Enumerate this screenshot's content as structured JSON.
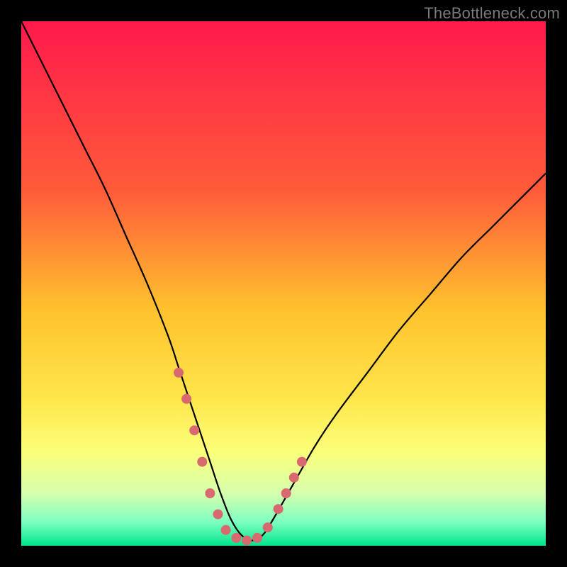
{
  "watermark": "TheBottleneck.com",
  "chart_data": {
    "type": "line",
    "title": "",
    "xlabel": "",
    "ylabel": "",
    "xlim": [
      0,
      100
    ],
    "ylim": [
      0,
      100
    ],
    "gradient_stops": [
      {
        "offset": 0,
        "color": "#ff1a4b"
      },
      {
        "offset": 0.32,
        "color": "#ff5a3a"
      },
      {
        "offset": 0.55,
        "color": "#ffc22e"
      },
      {
        "offset": 0.72,
        "color": "#ffe64a"
      },
      {
        "offset": 0.82,
        "color": "#fbff7a"
      },
      {
        "offset": 0.9,
        "color": "#d6ffad"
      },
      {
        "offset": 0.955,
        "color": "#7dffc1"
      },
      {
        "offset": 1.0,
        "color": "#00e58b"
      }
    ],
    "series": [
      {
        "name": "bottleneck-curve",
        "x": [
          0,
          4,
          8,
          12,
          16,
          20,
          24,
          28,
          30,
          32,
          34,
          36,
          38,
          40,
          42,
          44,
          46,
          48,
          52,
          56,
          60,
          66,
          72,
          78,
          84,
          90,
          96,
          100
        ],
        "y": [
          100,
          92,
          84,
          76,
          68,
          59,
          50,
          40,
          34,
          28,
          22,
          16,
          10,
          5,
          2,
          1,
          2,
          5,
          12,
          19,
          25,
          33,
          41,
          48,
          55,
          61,
          67,
          71
        ]
      }
    ],
    "highlight": {
      "color": "#d86a6f",
      "radius": 7,
      "points": [
        {
          "x": 30.0,
          "y": 33
        },
        {
          "x": 31.5,
          "y": 28
        },
        {
          "x": 33.0,
          "y": 22
        },
        {
          "x": 34.5,
          "y": 16
        },
        {
          "x": 36.0,
          "y": 10
        },
        {
          "x": 37.5,
          "y": 6
        },
        {
          "x": 39.0,
          "y": 3
        },
        {
          "x": 41.0,
          "y": 1.5
        },
        {
          "x": 43.0,
          "y": 1
        },
        {
          "x": 45.0,
          "y": 1.5
        },
        {
          "x": 47.0,
          "y": 3.5
        },
        {
          "x": 49.0,
          "y": 7
        },
        {
          "x": 50.5,
          "y": 10
        },
        {
          "x": 52.0,
          "y": 13
        },
        {
          "x": 53.5,
          "y": 16
        }
      ]
    }
  }
}
